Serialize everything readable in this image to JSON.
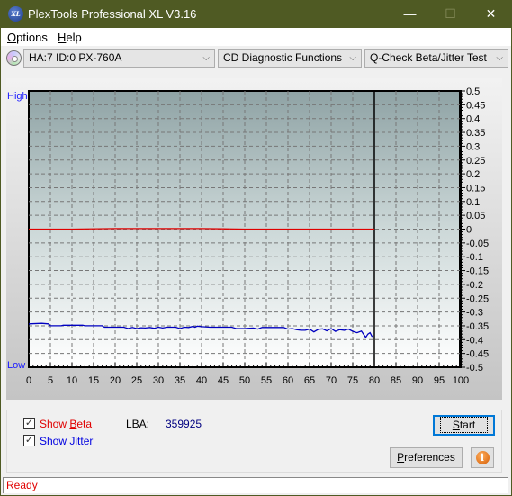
{
  "window": {
    "title": "PlexTools Professional XL V3.16",
    "app_icon_text": "XL",
    "minimize_glyph": "—",
    "maximize_glyph": "☐",
    "close_glyph": "✕"
  },
  "menu": {
    "items": [
      {
        "label_first": "O",
        "label_rest": "ptions"
      },
      {
        "label_first": "H",
        "label_rest": "elp"
      }
    ]
  },
  "toolbar": {
    "drive": "HA:7 ID:0  PX-760A",
    "function": "CD Diagnostic Functions",
    "test": "Q-Check Beta/Jitter Test",
    "dropdown_glyph": "⌵"
  },
  "chart_data": {
    "type": "line",
    "title": "",
    "left_axis": {
      "top_label": "High",
      "bottom_label": "Low"
    },
    "xlabel": "",
    "ylabel": "",
    "xlim": [
      0,
      100
    ],
    "ylim": [
      -0.5,
      0.5
    ],
    "x_ticks": [
      "0",
      "5",
      "10",
      "15",
      "20",
      "25",
      "30",
      "35",
      "40",
      "45",
      "50",
      "55",
      "60",
      "65",
      "70",
      "75",
      "80",
      "85",
      "90",
      "95",
      "100"
    ],
    "y_ticks": [
      "0.5",
      "0.45",
      "0.4",
      "0.35",
      "0.3",
      "0.25",
      "0.2",
      "0.15",
      "0.1",
      "0.05",
      "0",
      "-0.05",
      "-0.1",
      "-0.15",
      "-0.2",
      "-0.25",
      "-0.3",
      "-0.35",
      "-0.4",
      "-0.45",
      "-0.5"
    ],
    "grid": true,
    "end_marker_x": 80,
    "series": [
      {
        "name": "Beta",
        "color": "#e00000",
        "x": [
          0,
          10,
          20,
          30,
          40,
          45,
          50,
          60,
          70,
          80
        ],
        "y": [
          0,
          0,
          0.002,
          0.002,
          0.002,
          0.001,
          0,
          0,
          0,
          0
        ]
      },
      {
        "name": "Jitter",
        "color": "#0000c0",
        "x": [
          0,
          3,
          4.5,
          5,
          7.5,
          8,
          9,
          12.5,
          13,
          17,
          17.5,
          22,
          23,
          24,
          25,
          26,
          27,
          28,
          29,
          30,
          31,
          32,
          34,
          35,
          36,
          37,
          38,
          38.5,
          39,
          40,
          42,
          47,
          48,
          50,
          52,
          53,
          54,
          55,
          59,
          60,
          61,
          62,
          63,
          64,
          65,
          66,
          67,
          68,
          69,
          70,
          71,
          72,
          73,
          74,
          75,
          76,
          77,
          78,
          78.5,
          79,
          79.5
        ],
        "y": [
          -0.343,
          -0.341,
          -0.343,
          -0.35,
          -0.35,
          -0.348,
          -0.348,
          -0.348,
          -0.35,
          -0.35,
          -0.355,
          -0.355,
          -0.36,
          -0.356,
          -0.36,
          -0.357,
          -0.358,
          -0.356,
          -0.359,
          -0.355,
          -0.358,
          -0.355,
          -0.355,
          -0.36,
          -0.355,
          -0.356,
          -0.352,
          -0.355,
          -0.351,
          -0.353,
          -0.355,
          -0.355,
          -0.36,
          -0.36,
          -0.358,
          -0.362,
          -0.356,
          -0.356,
          -0.356,
          -0.362,
          -0.36,
          -0.364,
          -0.366,
          -0.366,
          -0.362,
          -0.372,
          -0.363,
          -0.361,
          -0.368,
          -0.36,
          -0.37,
          -0.364,
          -0.366,
          -0.362,
          -0.37,
          -0.375,
          -0.369,
          -0.392,
          -0.38,
          -0.375,
          -0.39
        ]
      }
    ]
  },
  "controls": {
    "show_beta": {
      "label_pre": "Show ",
      "label_u": "B",
      "label_post": "eta",
      "checked": true,
      "color": "#e00000"
    },
    "show_jitter": {
      "label_pre": "Show ",
      "label_u": "J",
      "label_post": "itter",
      "checked": true,
      "color": "#0000e0"
    },
    "lba_label": "LBA:",
    "lba_value": "359925",
    "check_glyph": "✓",
    "start_u": "S",
    "start_rest": "tart",
    "preferences_u": "P",
    "preferences_rest": "references",
    "info_glyph": "i"
  },
  "status": {
    "text": "Ready"
  }
}
